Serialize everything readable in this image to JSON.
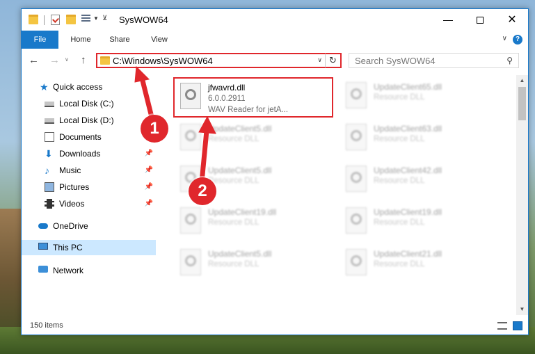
{
  "window": {
    "title": "SysWOW64",
    "minimize_glyph": "—",
    "close_glyph": "✕"
  },
  "ribbon": {
    "tabs": [
      {
        "label": "File",
        "active": true
      },
      {
        "label": "Home"
      },
      {
        "label": "Share"
      },
      {
        "label": "View"
      }
    ],
    "help_glyph": "?"
  },
  "address": {
    "path": "C:\\Windows\\SysWOW64",
    "search_placeholder": "Search SysWOW64"
  },
  "sidebar": {
    "items": [
      {
        "label": "Quick access",
        "icon": "star-icon"
      },
      {
        "label": "Local Disk (C:)",
        "icon": "drive-icon"
      },
      {
        "label": "Local Disk (D:)",
        "icon": "drive-icon"
      },
      {
        "label": "Documents",
        "icon": "documents-icon"
      },
      {
        "label": "Downloads",
        "icon": "downloads-icon",
        "pinned": true
      },
      {
        "label": "Music",
        "icon": "music-icon",
        "pinned": true
      },
      {
        "label": "Pictures",
        "icon": "pictures-icon",
        "pinned": true
      },
      {
        "label": "Videos",
        "icon": "videos-icon",
        "pinned": true
      },
      {
        "label": "OneDrive",
        "icon": "onedrive-icon"
      },
      {
        "label": "This PC",
        "icon": "this-pc-icon",
        "selected": true
      },
      {
        "label": "Network",
        "icon": "network-icon"
      }
    ]
  },
  "files": {
    "left": [
      {
        "name": "jfwavrd.dll",
        "line2": "6.0.0.2911",
        "line3": "WAV Reader for jetA...",
        "highlighted": true
      },
      {
        "name": "UpdateClient5.dll",
        "line2": "Resource DLL"
      },
      {
        "name": "UpdateClient5.dll",
        "line2": "Resource DLL"
      },
      {
        "name": "UpdateClient19.dll",
        "line2": "Resource DLL"
      },
      {
        "name": "UpdateClient5.dll",
        "line2": "Resource DLL"
      }
    ],
    "right": [
      {
        "name": "UpdateClient65.dll",
        "line2": "Resource DLL"
      },
      {
        "name": "UpdateClient63.dll",
        "line2": "Resource DLL"
      },
      {
        "name": "UpdateClient42.dll",
        "line2": "Resource DLL"
      },
      {
        "name": "UpdateClient19.dll",
        "line2": "Resource DLL"
      },
      {
        "name": "UpdateClient21.dll",
        "line2": "Resource DLL"
      }
    ]
  },
  "status": {
    "item_count": "150 items"
  },
  "annotations": {
    "badge1": "1",
    "badge2": "2",
    "color": "#e0272c"
  }
}
